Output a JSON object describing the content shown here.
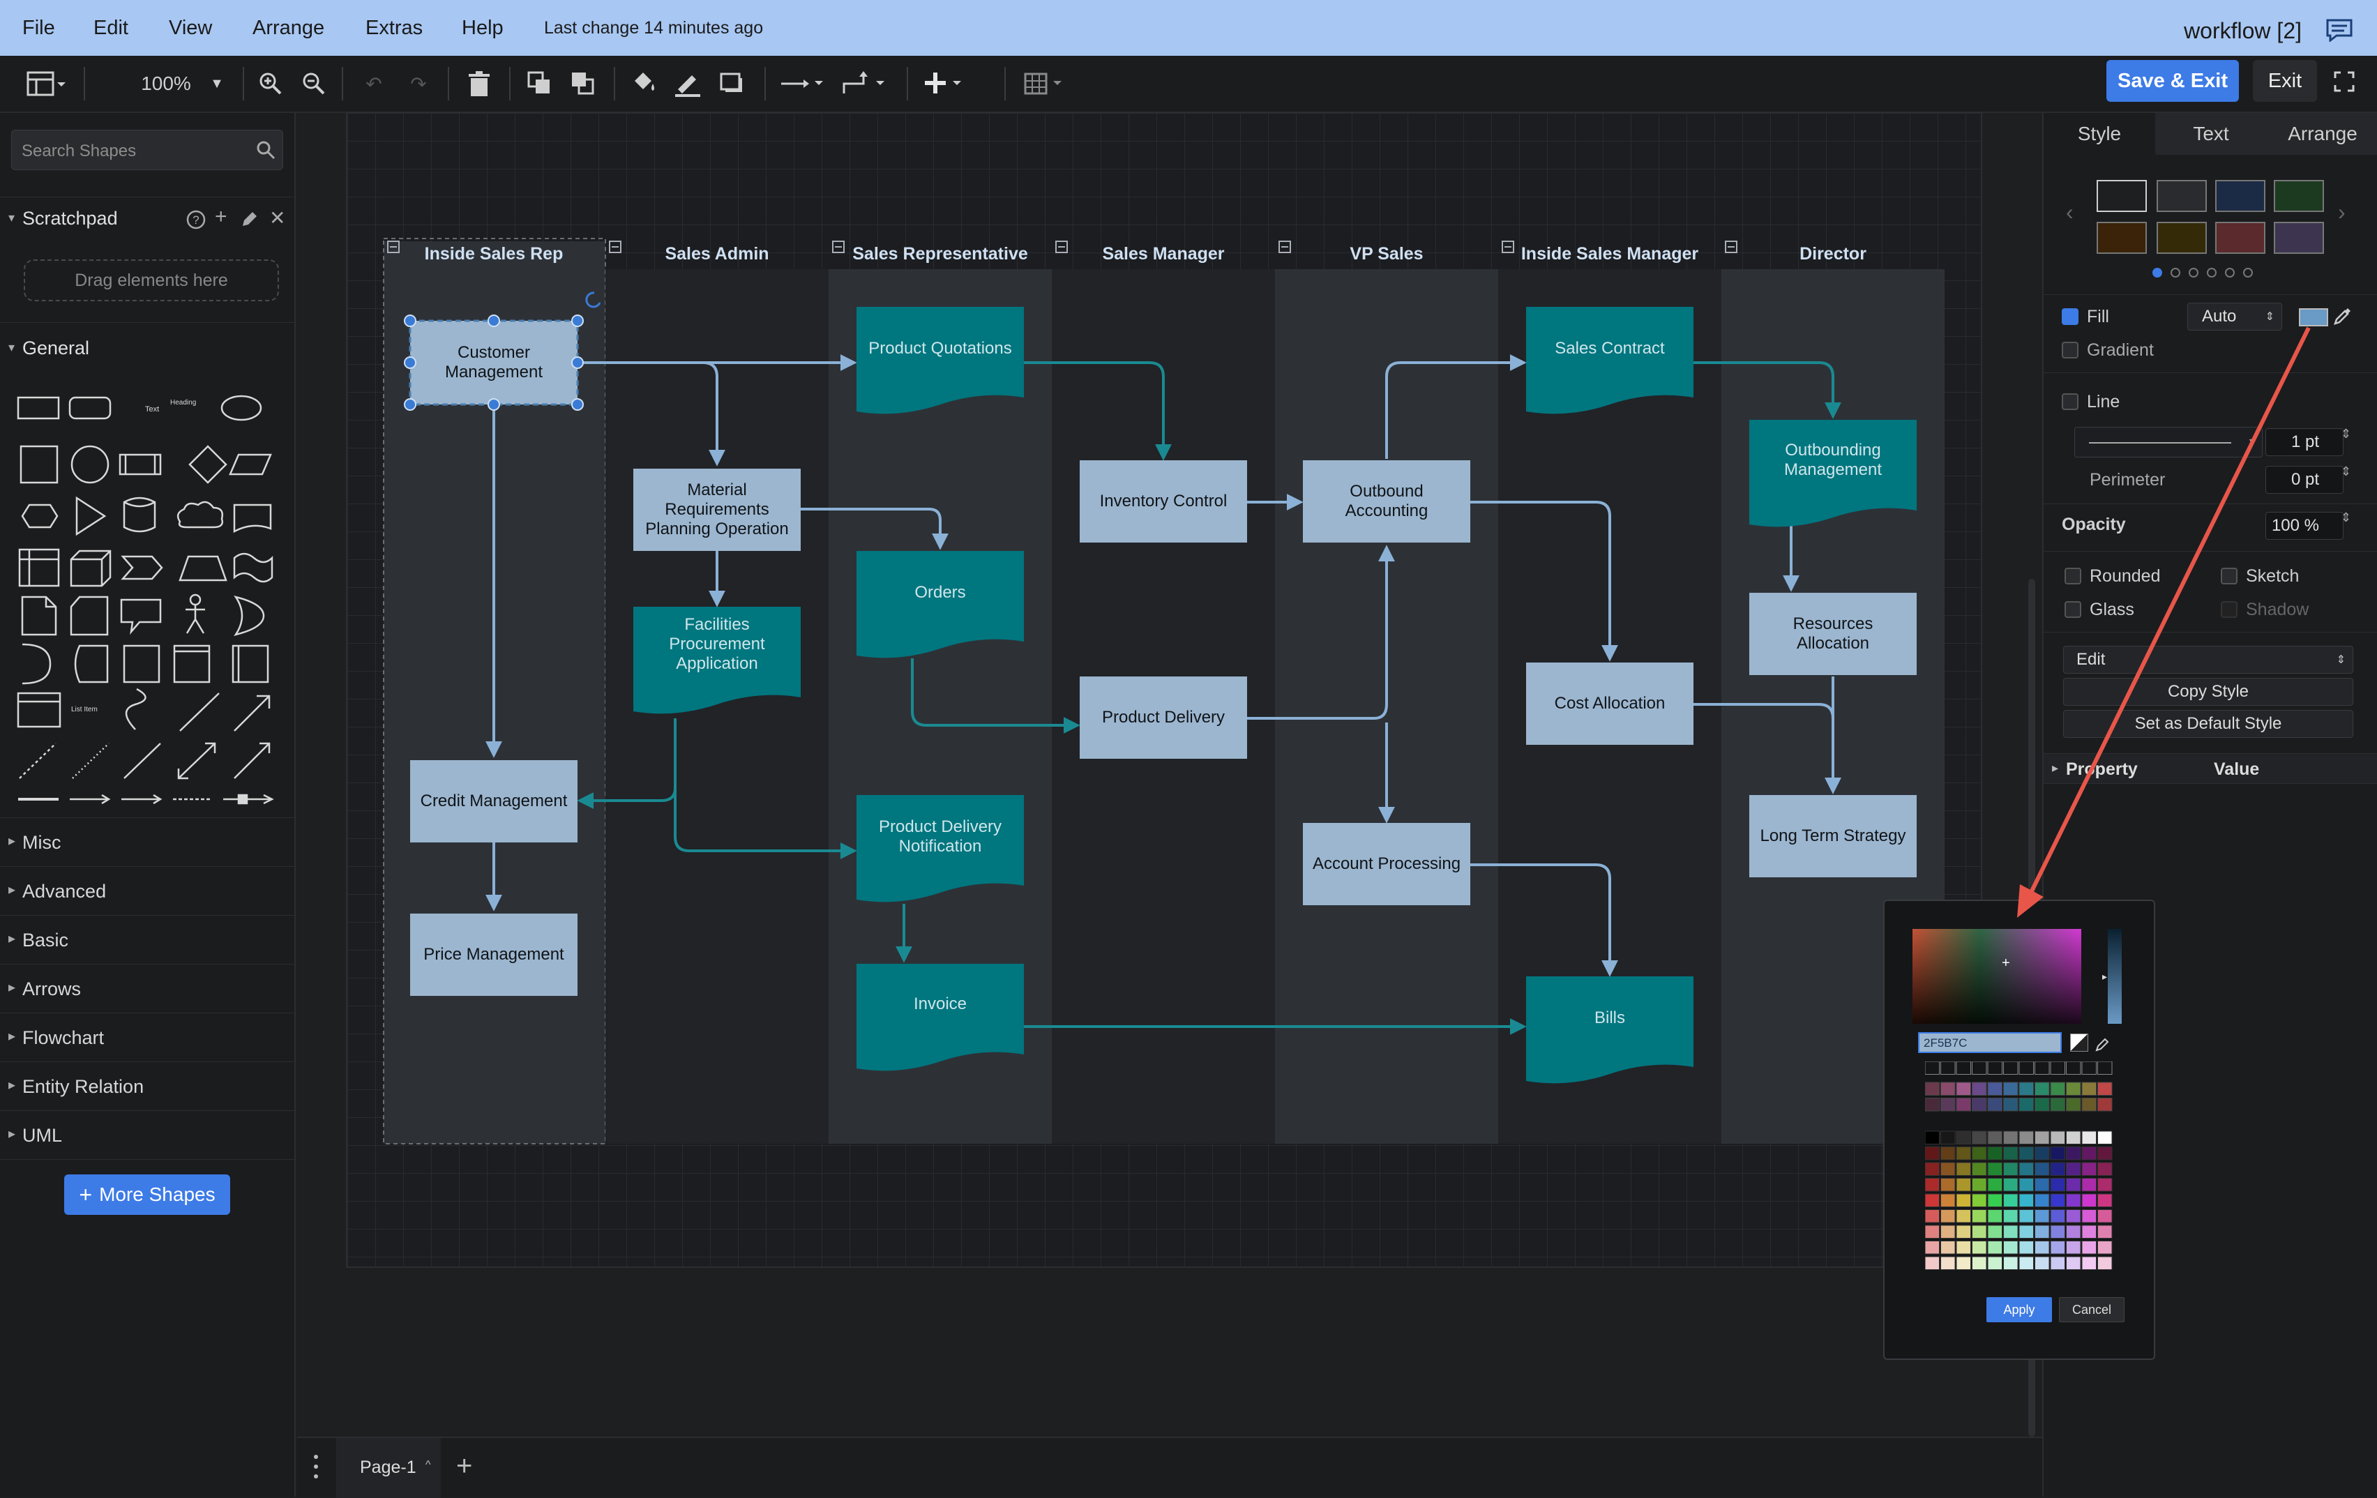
{
  "menubar": {
    "items": [
      "File",
      "Edit",
      "View",
      "Arrange",
      "Extras",
      "Help"
    ],
    "last_change": "Last change 14 minutes ago",
    "title": "workflow [2]"
  },
  "toolbar": {
    "zoom": "100%",
    "save_exit": "Save & Exit",
    "exit": "Exit"
  },
  "left": {
    "search_placeholder": "Search Shapes",
    "scratchpad": "Scratchpad",
    "drag_here": "Drag elements here",
    "general": "General",
    "categories": [
      "Misc",
      "Advanced",
      "Basic",
      "Arrows",
      "Flowchart",
      "Entity Relation",
      "UML"
    ],
    "more_shapes": "More Shapes",
    "shape_text": "Text",
    "shape_heading": "Heading",
    "shape_list": "List Item"
  },
  "diagram": {
    "lanes": [
      "Inside Sales Rep",
      "Sales Admin",
      "Sales Representative",
      "Sales Manager",
      "VP Sales",
      "Inside Sales Manager",
      "Director"
    ],
    "nodes": {
      "customer": "Customer Management",
      "credit": "Credit Management",
      "price": "Price Management",
      "mrp": "Material Requirements Planning Operation",
      "facilities": "Facilities Procurement Application",
      "quotations": "Product Quotations",
      "orders": "Orders",
      "pdn": "Product Delivery Notification",
      "invoice": "Invoice",
      "inventory": "Inventory Control",
      "delivery": "Product Delivery",
      "outbound_acc": "Outbound Accounting",
      "account_proc": "Account Processing",
      "contract": "Sales Contract",
      "cost": "Cost Allocation",
      "bills": "Bills",
      "outbound_mgmt": "Outbounding Management",
      "resources": "Resources Allocation",
      "strategy": "Long Term Strategy"
    }
  },
  "right": {
    "tabs": [
      "Style",
      "Text",
      "Arrange"
    ],
    "fill": "Fill",
    "fill_mode": "Auto",
    "gradient": "Gradient",
    "line": "Line",
    "line_width": "1 pt",
    "perimeter": "Perimeter",
    "perimeter_value": "0 pt",
    "opacity": "Opacity",
    "opacity_value": "100 %",
    "rounded": "Rounded",
    "sketch": "Sketch",
    "glass": "Glass",
    "shadow": "Shadow",
    "edit": "Edit",
    "copy_style": "Copy Style",
    "set_default": "Set as Default Style",
    "property": "Property",
    "value": "Value"
  },
  "picker": {
    "hex": "2F5B7C",
    "apply": "Apply",
    "cancel": "Cancel"
  },
  "bottom": {
    "page": "Page-1"
  },
  "colors": {
    "accent": "#3d7be6",
    "node_light": "#9cb6cf",
    "node_teal": "#00767f",
    "connector": "#8bb1d6",
    "annotation_arrow": "#e8564a"
  }
}
